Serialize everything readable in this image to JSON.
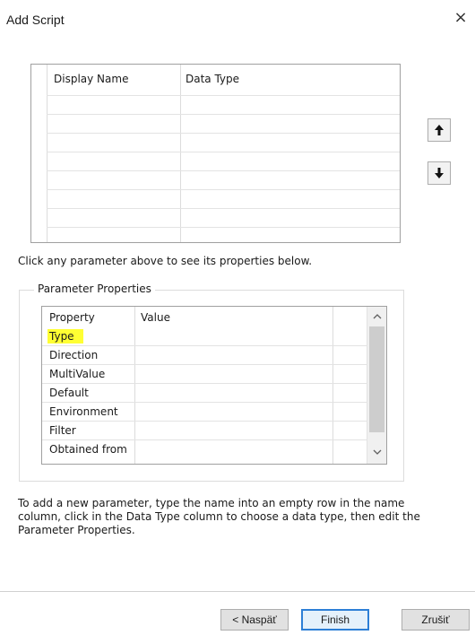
{
  "window": {
    "title": "Add Script",
    "close_glyph": "×"
  },
  "parameters_grid": {
    "columns": [
      "Display Name",
      "Data Type"
    ],
    "rows": [
      [
        "",
        ""
      ],
      [
        "",
        ""
      ],
      [
        "",
        ""
      ],
      [
        "",
        ""
      ],
      [
        "",
        ""
      ],
      [
        "",
        ""
      ],
      [
        "",
        ""
      ]
    ]
  },
  "move_buttons": {
    "up_icon": "arrow-up-icon",
    "down_icon": "arrow-down-icon"
  },
  "hint_select": "Click any parameter above to see its properties below.",
  "properties_group": {
    "legend": "Parameter Properties",
    "columns": [
      "Property",
      "Value"
    ],
    "rows": [
      {
        "property": "Type",
        "value": "",
        "highlight_color": "#ffff33"
      },
      {
        "property": "Direction",
        "value": ""
      },
      {
        "property": "MultiValue",
        "value": ""
      },
      {
        "property": "Default",
        "value": ""
      },
      {
        "property": "Environment",
        "value": ""
      },
      {
        "property": "Filter",
        "value": ""
      },
      {
        "property": "Obtained from",
        "value": ""
      }
    ]
  },
  "hint_add": "To add a new parameter, type the name into an empty row in the name column, click in the Data Type column to choose a data type, then edit the Parameter Properties.",
  "buttons": {
    "back": "< Naspäť",
    "finish": "Finish",
    "cancel": "Zrušiť"
  },
  "colors": {
    "accent": "#2d7fd6",
    "highlight": "#ffff33"
  }
}
